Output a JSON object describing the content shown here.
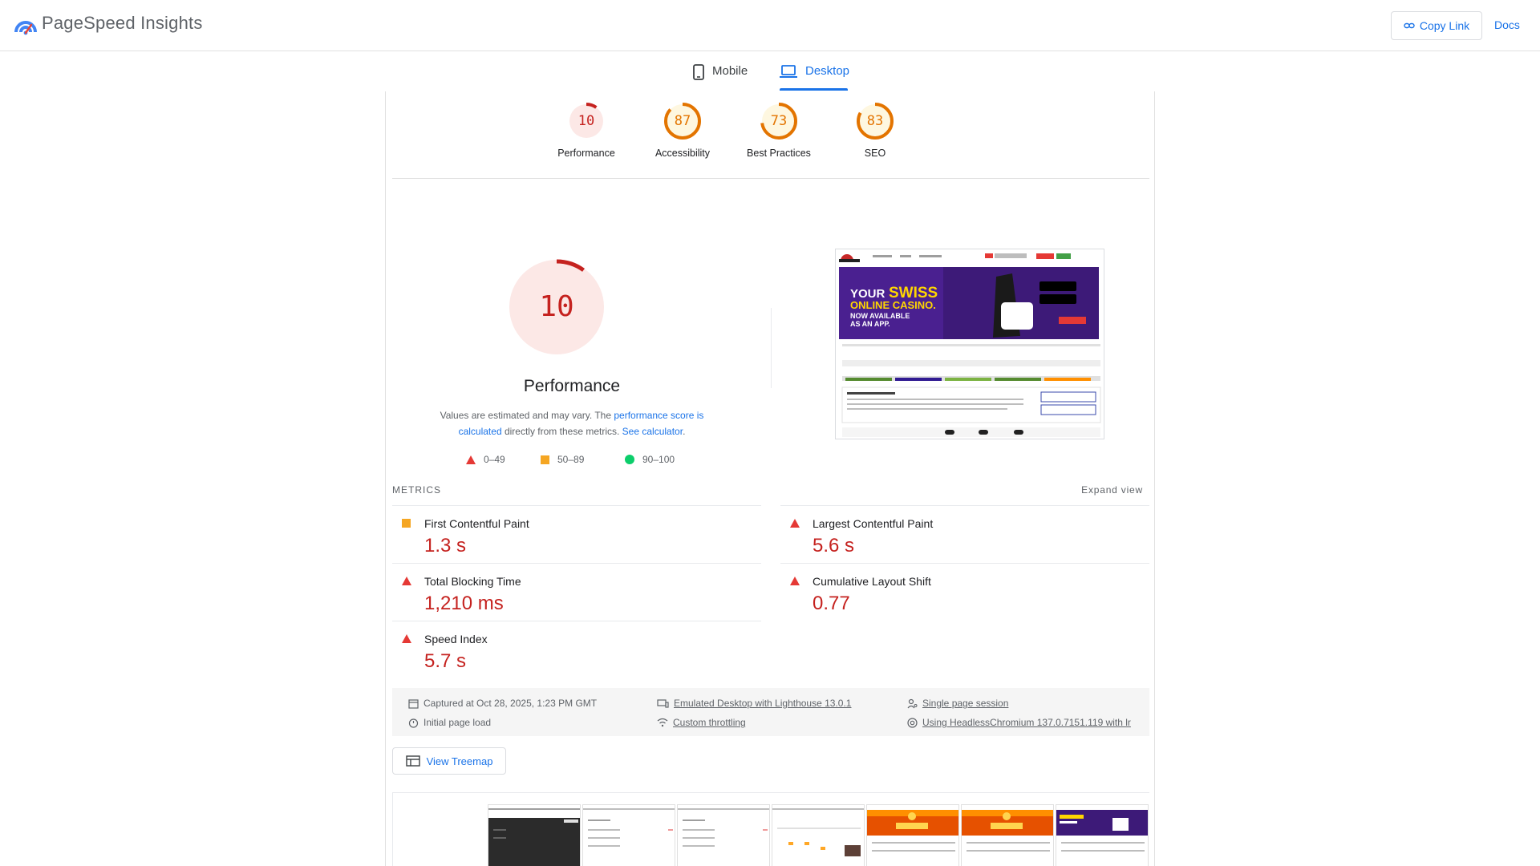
{
  "app": {
    "title": "PageSpeed Insights"
  },
  "header": {
    "copy_link": "Copy Link",
    "docs": "Docs"
  },
  "tabs": [
    {
      "label": "Mobile"
    },
    {
      "label": "Desktop"
    }
  ],
  "categories": [
    {
      "score": 10,
      "label": "Performance",
      "color": "#c5221f",
      "bg": "#fce8e6"
    },
    {
      "score": 87,
      "label": "Accessibility",
      "color": "#e37400",
      "bg": "#fef7e0"
    },
    {
      "score": 73,
      "label": "Best Practices",
      "color": "#e37400",
      "bg": "#fef7e0"
    },
    {
      "score": 83,
      "label": "SEO",
      "color": "#e37400",
      "bg": "#fef7e0"
    }
  ],
  "performance": {
    "score": 10,
    "title": "Performance",
    "desc_prefix": "Values are estimated and may vary. The ",
    "desc_link1": "performance score is calculated",
    "desc_mid": " directly from these metrics. ",
    "desc_link2": "See calculator",
    "desc_suffix": "."
  },
  "legend": [
    {
      "range": "0–49"
    },
    {
      "range": "50–89"
    },
    {
      "range": "90–100"
    }
  ],
  "screenshot": {
    "hero_line1": "YOUR ",
    "hero_swiss": "SWISS",
    "hero_line2": "ONLINE CASINO.",
    "hero_line3": "NOW AVAILABLE",
    "hero_line4": "AS AN APP."
  },
  "metrics": {
    "heading": "METRICS",
    "expand": "Expand view",
    "items": [
      {
        "label": "First Contentful Paint",
        "value": "1.3 s",
        "rating": "average"
      },
      {
        "label": "Largest Contentful Paint",
        "value": "5.6 s",
        "rating": "fail"
      },
      {
        "label": "Total Blocking Time",
        "value": "1,210 ms",
        "rating": "fail"
      },
      {
        "label": "Cumulative Layout Shift",
        "value": "0.77",
        "rating": "fail"
      },
      {
        "label": "Speed Index",
        "value": "5.7 s",
        "rating": "fail"
      }
    ]
  },
  "runtime": {
    "captured": "Captured at Oct 28, 2025, 1:23 PM GMT",
    "initial_load": "Initial page load",
    "emulated": "Emulated Desktop with Lighthouse 13.0.1",
    "throttling": "Custom throttling",
    "session": "Single page session",
    "browser": "Using HeadlessChromium 137.0.7151.119 with lr"
  },
  "treemap": {
    "label": "View Treemap"
  },
  "colors": {
    "accent": "#1a73e8",
    "fail": "#c5221f",
    "average": "#e37400",
    "pass": "#0cce6b"
  }
}
